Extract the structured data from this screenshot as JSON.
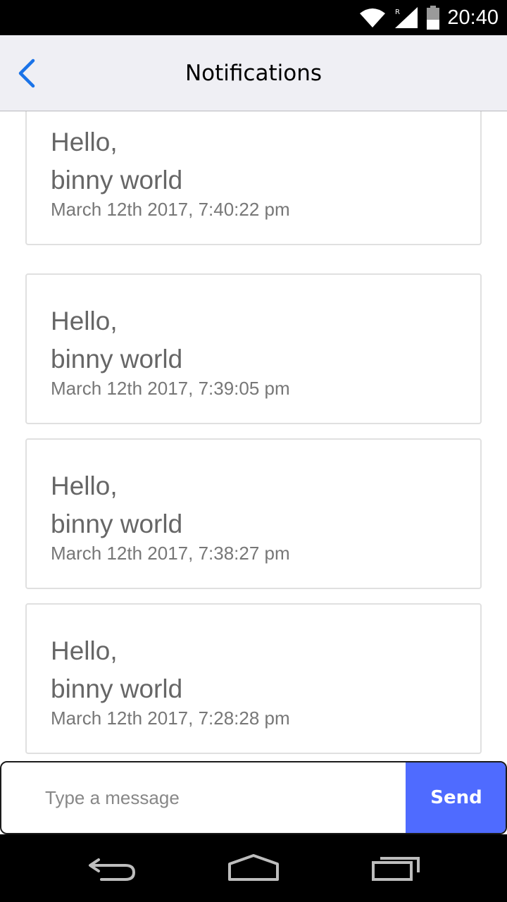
{
  "status_bar": {
    "time": "20:40",
    "icons": [
      "wifi-icon",
      "signal-roaming-icon",
      "battery-icon"
    ]
  },
  "app_bar": {
    "title": "Notifications",
    "back_icon": "chevron-left-icon",
    "accent_color": "#1a73e8"
  },
  "notifications": [
    {
      "line1": "Hello,",
      "line2": "binny world",
      "timestamp": "March 12th 2017, 7:40:22 pm"
    },
    {
      "line1": "Hello,",
      "line2": "binny world",
      "timestamp": "March 12th 2017, 7:39:05 pm"
    },
    {
      "line1": "Hello,",
      "line2": "binny world",
      "timestamp": "March 12th 2017, 7:38:27 pm"
    },
    {
      "line1": "Hello,",
      "line2": "binny world",
      "timestamp": "March 12th 2017, 7:28:28 pm"
    }
  ],
  "composer": {
    "placeholder": "Type a message",
    "value": "",
    "send_label": "Send",
    "send_color": "#4f6bff"
  },
  "nav_bar": {
    "buttons": [
      "back-icon",
      "home-icon",
      "recents-icon"
    ]
  }
}
